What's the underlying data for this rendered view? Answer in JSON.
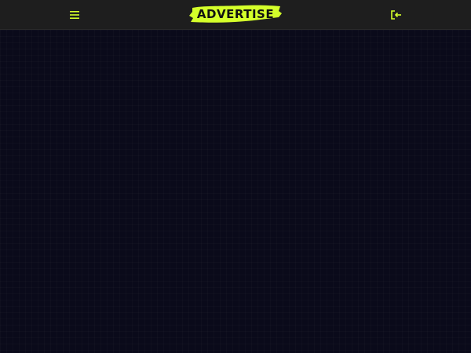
{
  "header": {
    "logo_text": "ADVERTISE",
    "menu_icon": "hamburger-menu-icon",
    "login_icon": "sign-in-icon"
  },
  "colors": {
    "accent": "#d4ff2a",
    "header_bg": "#1e1e1e",
    "page_bg": "#0a0a1a",
    "logo_text": "#111111"
  }
}
